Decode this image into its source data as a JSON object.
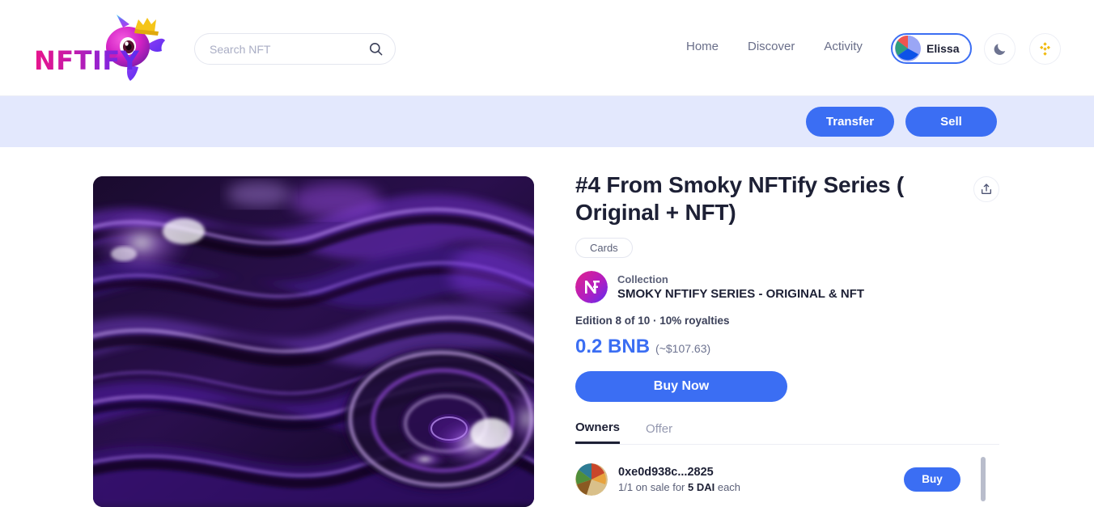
{
  "header": {
    "logo_text": "NFTIFY",
    "logo_icon": "unicorn-fish-mascot",
    "search": {
      "placeholder": "Search NFT",
      "value": "",
      "icon": "search-icon"
    },
    "nav": [
      {
        "label": "Home"
      },
      {
        "label": "Discover"
      },
      {
        "label": "Activity"
      }
    ],
    "user": {
      "name": "Elissa",
      "avatar_icon": "pie-identicon-avatar"
    },
    "theme_toggle_icon": "moon-icon",
    "chain_icon": "bnb-icon"
  },
  "action_bar": {
    "transfer_label": "Transfer",
    "sell_label": "Sell"
  },
  "main": {
    "artwork": {
      "alt": "abstract purple fluid marble artwork",
      "icon": "nft-artwork"
    },
    "title": "#4 From Smoky NFTify Series ( Original + NFT)",
    "share_icon": "share-icon",
    "category_chip": "Cards",
    "collection": {
      "label": "Collection",
      "name": "SMOKY NFTIFY SERIES - ORIGINAL & NFT",
      "avatar_icon": "nftify-collection-logo"
    },
    "edition": "Edition 8 of 10 · 10% royalties",
    "price": {
      "amount": "0.2 BNB",
      "usd": "(~$107.63)"
    },
    "buy_now_label": "Buy Now",
    "tabs": [
      {
        "label": "Owners",
        "active": true
      },
      {
        "label": "Offer",
        "active": false
      }
    ],
    "owners": [
      {
        "address": "0xe0d938c...2825",
        "detail_prefix": "1/1 on sale for ",
        "detail_amount": "5 DAI",
        "detail_suffix": " each",
        "buy_label": "Buy",
        "avatar_icon": "pie-identicon-avatar"
      }
    ]
  },
  "colors": {
    "accent_blue": "#3b6ef3",
    "action_bar_bg": "#e3e8fd",
    "bnb_gold": "#f0b90b",
    "text_dark": "#1d2035",
    "text_muted": "#696e89"
  }
}
